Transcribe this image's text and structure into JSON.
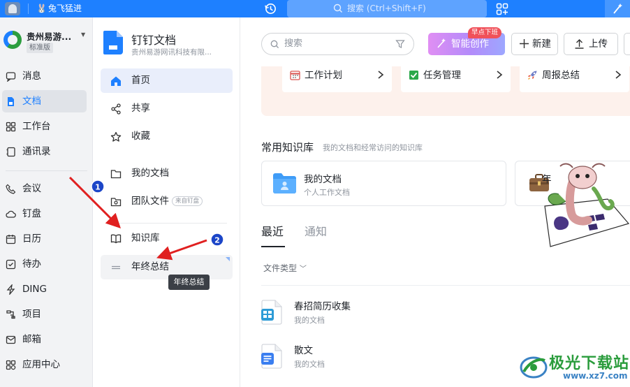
{
  "topbar": {
    "tab_label": "兔飞猛进",
    "search_placeholder": "搜索 (Ctrl+Shift+F)",
    "accent": "#1e80ff"
  },
  "org": {
    "name": "贵州易游...",
    "plan": "标准版"
  },
  "leftnav": {
    "items": [
      {
        "label": "消息",
        "icon": "message-icon"
      },
      {
        "label": "文档",
        "icon": "document-icon"
      },
      {
        "label": "工作台",
        "icon": "workbench-icon"
      },
      {
        "label": "通讯录",
        "icon": "contacts-icon"
      },
      {
        "label": "会议",
        "icon": "phone-icon"
      },
      {
        "label": "钉盘",
        "icon": "cloud-drive-icon"
      },
      {
        "label": "日历",
        "icon": "calendar-icon"
      },
      {
        "label": "待办",
        "icon": "todo-icon"
      },
      {
        "label": "DING",
        "icon": "ding-icon"
      },
      {
        "label": "项目",
        "icon": "project-icon"
      },
      {
        "label": "邮箱",
        "icon": "mail-icon"
      },
      {
        "label": "应用中心",
        "icon": "app-center-icon"
      }
    ],
    "active_index": 1
  },
  "docnav": {
    "title": "钉钉文档",
    "org": "贵州易游网讯科技有限...",
    "items": [
      {
        "label": "首页",
        "icon": "home-icon"
      },
      {
        "label": "共享",
        "icon": "share-icon"
      },
      {
        "label": "收藏",
        "icon": "star-icon"
      },
      {
        "label": "我的文档",
        "icon": "folder-icon"
      },
      {
        "label": "团队文件",
        "icon": "team-files-icon",
        "badge": "来自钉盘"
      },
      {
        "label": "知识库",
        "icon": "book-icon"
      },
      {
        "label": "年终总结",
        "icon": "drag-handle-icon"
      }
    ],
    "tooltip": "年终总结"
  },
  "main": {
    "search_placeholder": "搜索",
    "ai_button": "智能创作",
    "ai_badge": "早点下班",
    "new_button": "新建",
    "upload_button": "上传",
    "templates": [
      {
        "label": "工作计划",
        "icon": "calendar-icon"
      },
      {
        "label": "任务管理",
        "icon": "checkbox-icon"
      },
      {
        "label": "周报总结",
        "icon": "rocket-icon"
      }
    ],
    "kb_title": "常用知识库",
    "kb_subtitle": "我的文档和经常访问的知识库",
    "kb_cards": [
      {
        "name": "我的文档",
        "desc": "个人工作文档"
      },
      {
        "name": "年",
        "desc": ""
      }
    ],
    "tabs": [
      "最近",
      "通知"
    ],
    "filter_label": "文件类型",
    "files": [
      {
        "name": "春招简历收集",
        "location": "我的文档",
        "icon": "table-doc-icon"
      },
      {
        "name": "散文",
        "location": "我的文档",
        "icon": "text-doc-icon"
      }
    ]
  },
  "annotations": {
    "marker_1": "1",
    "marker_2": "2"
  },
  "watermark": {
    "cn": "极光下载站",
    "en": "www.xz7.com"
  }
}
